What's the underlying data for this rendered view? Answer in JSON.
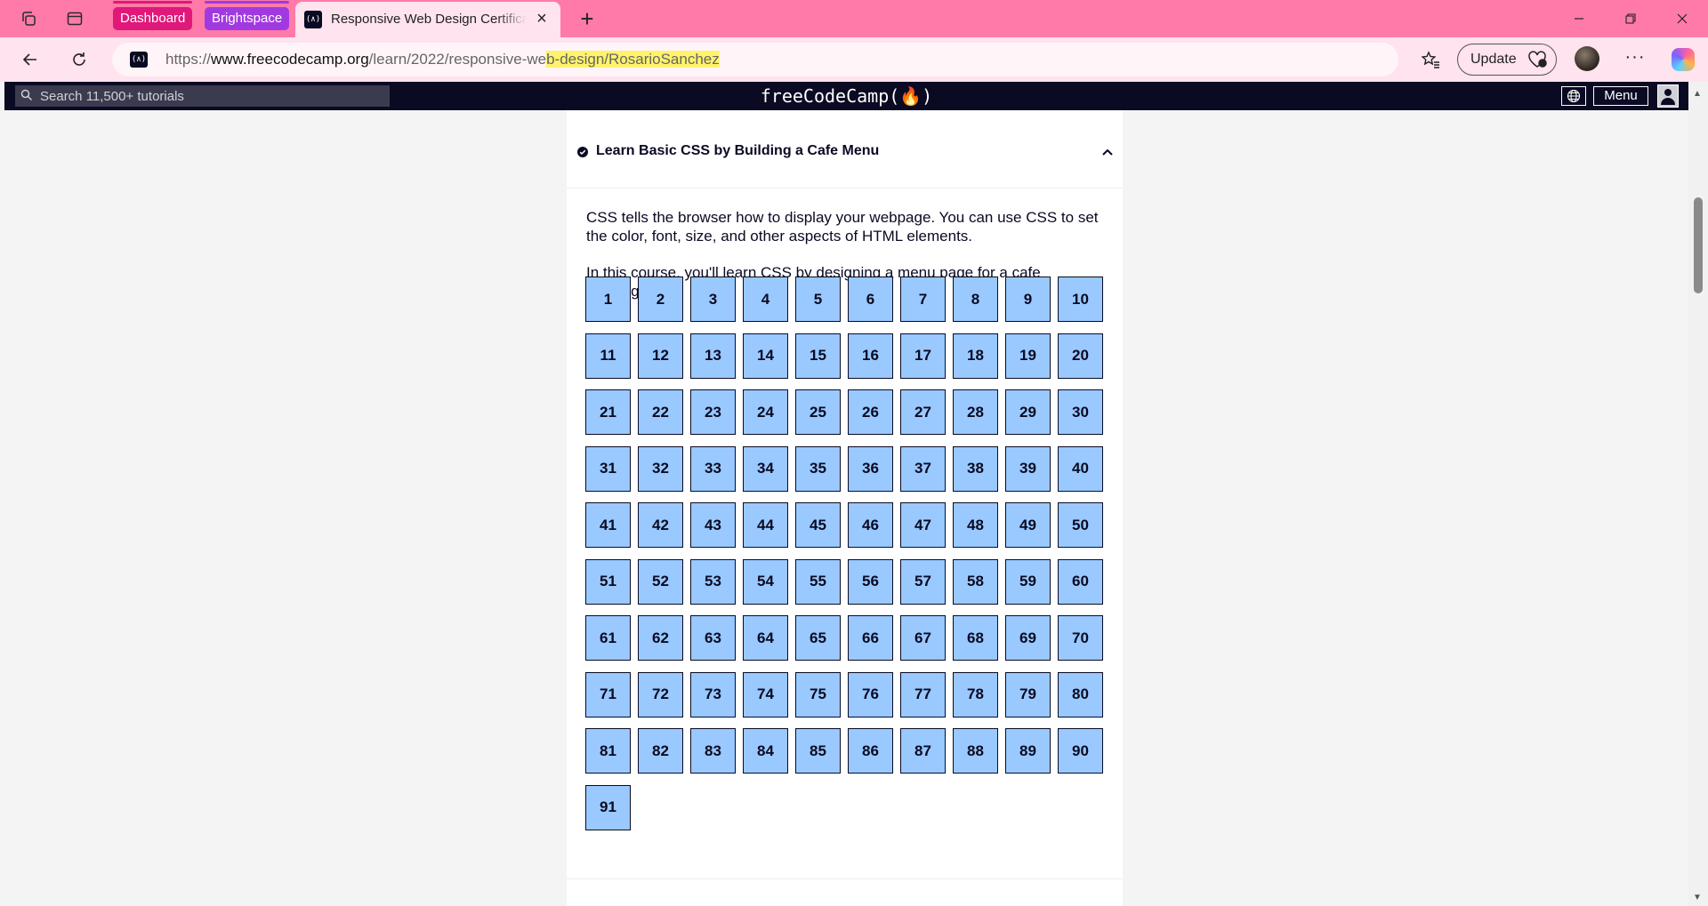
{
  "browser": {
    "tab_groups": [
      {
        "label": "Dashboard",
        "color": "#e0187a"
      },
      {
        "label": "Brightspace",
        "color": "#a03ae0"
      }
    ],
    "active_tab": {
      "title": "Responsive Web Design Certification",
      "favicon_text": "(∧)"
    },
    "new_tab_label": "+",
    "url": {
      "scheme": "https://",
      "host": "www.freecodecamp.org",
      "path_plain": "/learn/2022/responsive-we",
      "path_highlighted": "b-design/RosarioSanchez"
    },
    "update_button": "Update",
    "more_label": "···",
    "accent_tab_bar": "#ff7aa8"
  },
  "fcc_nav": {
    "search_placeholder": "Search 11,500+ tutorials",
    "logo": "freeCodeCamp(🔥)",
    "menu_label": "Menu"
  },
  "block": {
    "title": "Learn Basic CSS by Building a Cafe Menu",
    "completed": true,
    "expanded": true,
    "description": [
      "CSS tells the browser how to display your webpage. You can use CSS to set the color, font, size, and other aspects of HTML elements.",
      "In this course, you'll learn CSS by designing a menu page for a cafe webpage."
    ],
    "step_count": 91,
    "step_color": "#99c9ff"
  }
}
